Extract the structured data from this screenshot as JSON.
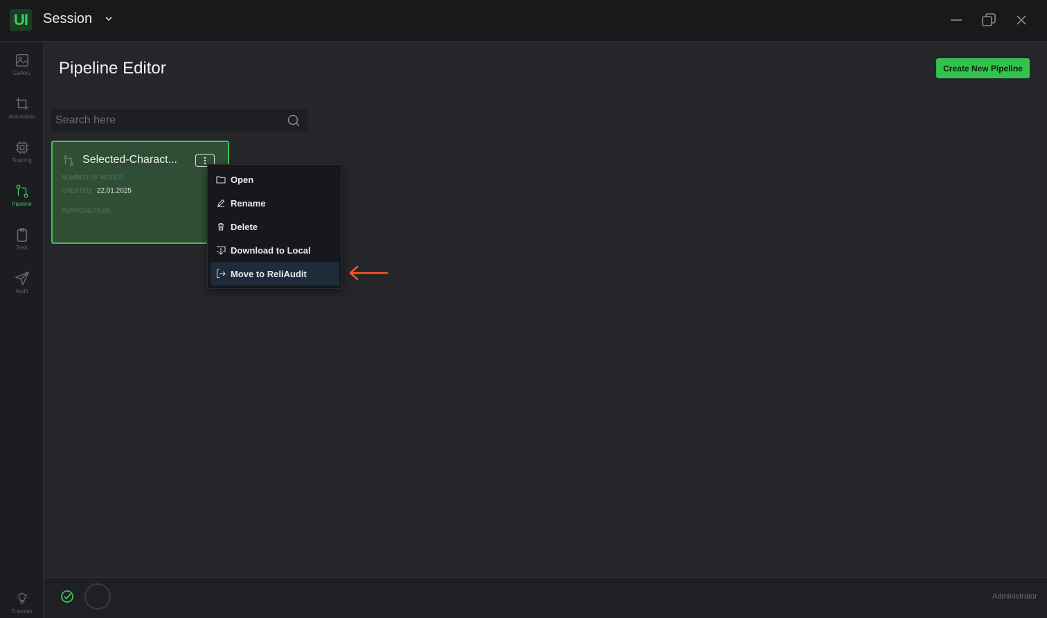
{
  "app": {
    "logo": "UI",
    "title": "Session"
  },
  "sidebar": {
    "items": [
      {
        "label": "Gallery",
        "icon": "image-icon"
      },
      {
        "label": "Annotation",
        "icon": "crop-icon"
      },
      {
        "label": "Training",
        "icon": "chip-icon"
      },
      {
        "label": "Pipeline",
        "icon": "pipeline-icon",
        "active": true
      },
      {
        "label": "Task",
        "icon": "clipboard-icon"
      },
      {
        "label": "Audit",
        "icon": "send-icon"
      }
    ],
    "bottom": {
      "label": "Tutorials",
      "icon": "lightbulb-icon"
    }
  },
  "main": {
    "title": "Pipeline Editor",
    "create_button": "Create New Pipeline",
    "search": {
      "placeholder": "Search here",
      "value": ""
    }
  },
  "card": {
    "title": "Selected-Charact...",
    "nodes_label": "NUMBER OF NODES:",
    "nodes_value": "",
    "created_label": "CREATED:",
    "created_value": "22.01.2025",
    "purpose_label": "PURPOSE/TASK:",
    "purpose_value": ""
  },
  "context_menu": {
    "items": [
      {
        "label": "Open",
        "icon": "folder-icon"
      },
      {
        "label": "Rename",
        "icon": "pencil-icon"
      },
      {
        "label": "Delete",
        "icon": "trash-icon"
      },
      {
        "label": "Download to Local",
        "icon": "download-icon"
      },
      {
        "label": "Move to ReliAudit",
        "icon": "move-icon",
        "highlighted": true
      }
    ]
  },
  "status": {
    "user": "Administrator"
  },
  "colors": {
    "accent": "#33c24d",
    "annotation_arrow": "#ff5a1f",
    "menu_highlight": "#1d2b3a"
  }
}
